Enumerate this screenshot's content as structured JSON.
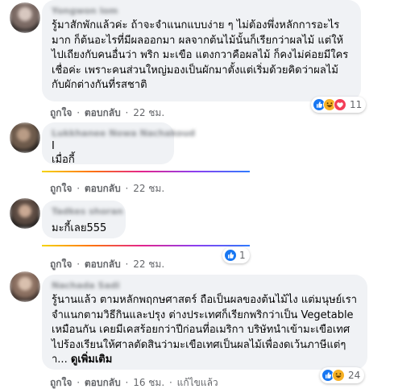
{
  "comments": [
    {
      "author": "Yongwon lom",
      "text": "รู้มาสักพักแล้วค่ะ ถ้าจะจำแนกแบบง่าย ๆ ไม่ต้องพึ่งหลักการอะไรมาก ก็ต้นอะไรที่มีผลออกมา ผลจากต้นไม้นั้นก็เรียกว่าผลไม้ แต่ให้ไปเถียงกับคนอื่นว่า พริก มะเขือ แตงกวาคือผลไม้ ก็คงไม่ค่อยมีใครเชื่อค่ะ เพราะคนส่วนใหญ่มองเป็นผักมาตั้งแต่เริ่มด้วยคิดว่าผลไม้กับผักต่างกันที่รสชาติ",
      "like": "ถูกใจ",
      "reply": "ตอบกลับ",
      "time": "22 ชม.",
      "reaction_count": "11",
      "reaction_icons": [
        "like-icon",
        "haha-icon",
        "love-icon"
      ]
    },
    {
      "author": "Lukkhanee Nowa Nachakoud",
      "text_line1": "I",
      "text_line2": "เมื่อกี้",
      "like": "ถูกใจ",
      "reply": "ตอบกลับ",
      "time": "22 ชม."
    },
    {
      "author": "Tadkes shoran",
      "text": "มะกี้เลย555",
      "like": "ถูกใจ",
      "reply": "ตอบกลับ",
      "time": "22 ชม.",
      "reaction_count": "1",
      "reaction_icons": [
        "like-icon"
      ]
    },
    {
      "author": "Nachada Sadi",
      "text": "รู้นานแล้ว ตามหลักพฤกษศาสตร์ ถือเป็นผลของต้นไม้ไง แต่มนุษย์เราจำแนกตามวิธีกินและปรุง ต่างประเทศก็เรียกพริกว่าเป็น Vegetable เหมือนกัน เคยมีเคสร้อยกว่าปีก่อนที่อเมริกา บริษัทนำเข้ามะเขือเทศไปร้องเรียนให้ศาลตัดสินว่ามะเขือเทศเป็นผลไม้เพื่องดเว้นภาษีแต่ๆา...",
      "see_more": "ดูเพิ่มเติม",
      "like": "ถูกใจ",
      "reply": "ตอบกลับ",
      "time": "16 ชม.",
      "edited": "แก้ไขแล้ว",
      "reaction_count": "24",
      "reaction_icons": [
        "like-icon",
        "haha-icon"
      ]
    }
  ],
  "colors": {
    "bubble": "#f0f2f5",
    "action_text": "#65676b",
    "like_blue": "#1877f2",
    "haha_yellow": "#f7b125",
    "love_red": "#f33e58"
  }
}
